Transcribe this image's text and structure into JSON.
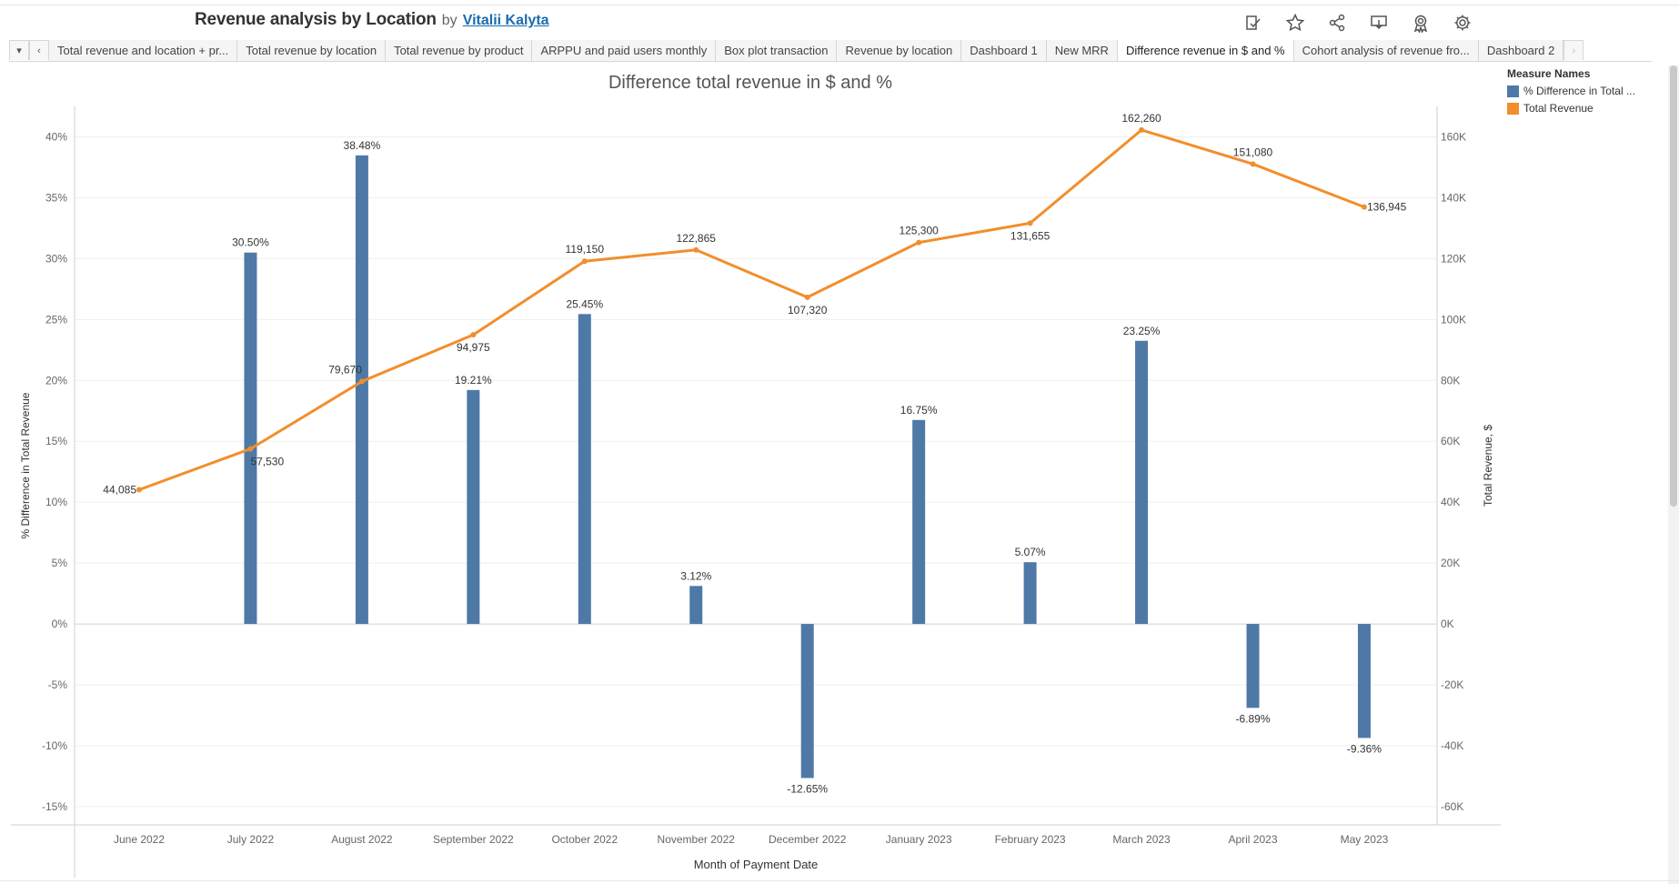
{
  "header": {
    "title": "Revenue analysis by Location",
    "by": "by",
    "author": "Vitalii Kalyta"
  },
  "toolbar": {
    "icons": [
      "data-guide-icon",
      "star-icon",
      "share-icon",
      "download-icon",
      "badge-icon",
      "gear-icon"
    ]
  },
  "tabs": {
    "prev_symbol": "‹",
    "next_symbol": "›",
    "dropdown_symbol": "▾",
    "items": [
      "Total revenue and location + pr...",
      "Total revenue by location",
      "Total revenue by product",
      "ARPPU and paid users monthly",
      "Box plot transaction",
      "Revenue by location",
      "Dashboard 1",
      "New MRR",
      "Difference revenue in $ and %",
      "Cohort analysis of revenue fro...",
      "Dashboard 2"
    ],
    "active_index": 8
  },
  "legend": {
    "title": "Measure Names",
    "items": [
      {
        "label": "% Difference in Total ...",
        "color": "#4e79a7"
      },
      {
        "label": "Total Revenue",
        "color": "#f28e2b"
      }
    ]
  },
  "chart_data": {
    "type": "bar",
    "title": "Difference total revenue in $ and %",
    "xlabel": "Month of Payment Date",
    "ylabel": "% Difference in Total Revenue",
    "y2label": "Total Revenue, $",
    "categories": [
      "June 2022",
      "July 2022",
      "August 2022",
      "September 2022",
      "October 2022",
      "November 2022",
      "December 2022",
      "January 2023",
      "February 2023",
      "March 2023",
      "April 2023",
      "May 2023"
    ],
    "series": [
      {
        "name": "% Difference in Total Revenue",
        "type": "bar",
        "axis": "left",
        "color": "#4e79a7",
        "values": [
          null,
          30.5,
          38.48,
          19.21,
          25.45,
          3.12,
          -12.65,
          16.75,
          5.07,
          23.25,
          -6.89,
          -9.36
        ],
        "labels": [
          "",
          "30.50%",
          "38.48%",
          "19.21%",
          "25.45%",
          "3.12%",
          "-12.65%",
          "16.75%",
          "5.07%",
          "23.25%",
          "-6.89%",
          "-9.36%"
        ]
      },
      {
        "name": "Total Revenue",
        "type": "line",
        "axis": "right",
        "color": "#f28e2b",
        "values": [
          44085,
          57530,
          79670,
          94975,
          119150,
          122865,
          107320,
          125300,
          131655,
          162260,
          151080,
          136945
        ],
        "labels": [
          "44,085",
          "57,530",
          "79,670",
          "94,975",
          "119,150",
          "122,865",
          "107,320",
          "125,300",
          "131,655",
          "162,260",
          "151,080",
          "136,945"
        ]
      }
    ],
    "ylim": [
      -16.5,
      42.5
    ],
    "y2lim": [
      -66000,
      170000
    ],
    "yticks": [
      {
        "v": 40,
        "label": "40%"
      },
      {
        "v": 35,
        "label": "35%"
      },
      {
        "v": 30,
        "label": "30%"
      },
      {
        "v": 25,
        "label": "25%"
      },
      {
        "v": 20,
        "label": "20%"
      },
      {
        "v": 15,
        "label": "15%"
      },
      {
        "v": 10,
        "label": "10%"
      },
      {
        "v": 5,
        "label": "5%"
      },
      {
        "v": 0,
        "label": "0%"
      },
      {
        "v": -5,
        "label": "-5%"
      },
      {
        "v": -10,
        "label": "-10%"
      },
      {
        "v": -15,
        "label": "-15%"
      }
    ],
    "y2ticks": [
      {
        "v": 160000,
        "label": "160K"
      },
      {
        "v": 140000,
        "label": "140K"
      },
      {
        "v": 120000,
        "label": "120K"
      },
      {
        "v": 100000,
        "label": "100K"
      },
      {
        "v": 80000,
        "label": "80K"
      },
      {
        "v": 60000,
        "label": "60K"
      },
      {
        "v": 40000,
        "label": "40K"
      },
      {
        "v": 20000,
        "label": "20K"
      },
      {
        "v": 0,
        "label": "0K"
      },
      {
        "v": -20000,
        "label": "-20K"
      },
      {
        "v": -40000,
        "label": "-40K"
      },
      {
        "v": -60000,
        "label": "-60K"
      }
    ],
    "grid": true,
    "legend_position": "top-right"
  }
}
